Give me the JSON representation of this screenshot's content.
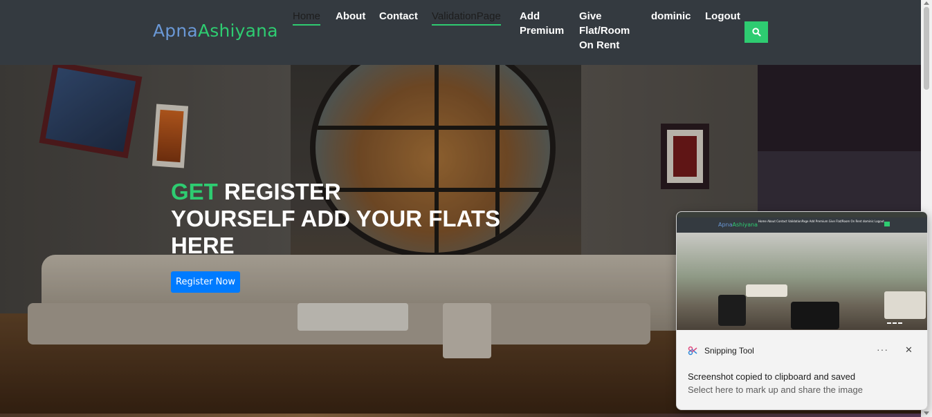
{
  "header": {
    "brand_part1": "Apna",
    "brand_part2": "Ashiyana",
    "nav": {
      "home": "Home",
      "about": "About",
      "contact": "Contact",
      "validation": "ValidationPage",
      "add_premium_line1": "Add",
      "add_premium_line2": "Premium",
      "give_line1": "Give",
      "give_line2": "Flat/Room",
      "give_line3": "On Rent",
      "user": "dominic",
      "logout": "Logout"
    },
    "search_icon": "search-icon"
  },
  "hero": {
    "title_accent": "GET",
    "title_line1_rest": " REGISTER",
    "title_line2": "YOURSELF ADD YOUR FLATS",
    "title_line3": "HERE",
    "cta_label": "Register Now"
  },
  "toast": {
    "app_name": "Snipping Tool",
    "more_label": "···",
    "close_label": "✕",
    "title": "Screenshot copied to clipboard and saved",
    "subtitle": "Select here to mark up and share the image",
    "thumb_brand_part1": "Apna",
    "thumb_brand_part2": "Ashiyana",
    "thumb_nav": "Home  About  Contact  ValidationPage  Add Premium  Give Flat/Room On Rent  dominic  Logout"
  },
  "colors": {
    "navbar_bg": "#343a40",
    "accent_green": "#2ecc71",
    "brand_blue": "#6a98d6",
    "cta_blue": "#007bff"
  }
}
